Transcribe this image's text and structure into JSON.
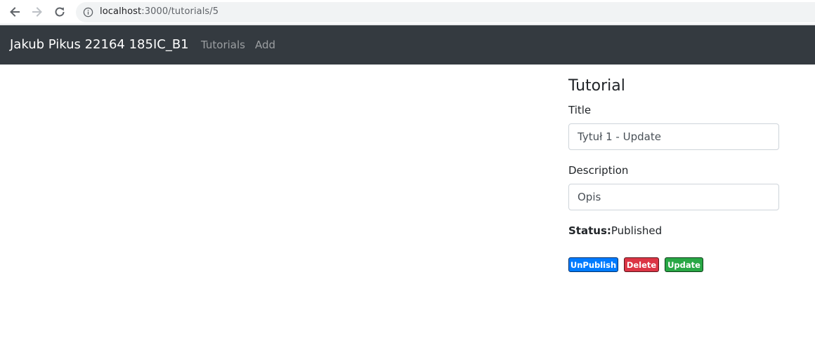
{
  "browser": {
    "url_host": "localhost",
    "url_path": ":3000/tutorials/5",
    "back_icon": "arrow-left-icon",
    "forward_icon": "arrow-right-icon",
    "reload_icon": "reload-icon",
    "info_icon": "info-icon"
  },
  "navbar": {
    "brand": "Jakub Pikus 22164 185IC_B1",
    "links": [
      "Tutorials",
      "Add"
    ]
  },
  "tutorial": {
    "heading": "Tutorial",
    "title_label": "Title",
    "title_value": "Tytuł 1 - Update",
    "description_label": "Description",
    "description_value": "Opis",
    "status_key": "Status:",
    "status_value": "Published",
    "buttons": {
      "unpublish": "UnPublish",
      "delete": "Delete",
      "update": "Update"
    }
  },
  "colors": {
    "navbar_bg": "#343a40",
    "primary": "#007bff",
    "danger": "#dc3545",
    "success": "#28a745"
  }
}
